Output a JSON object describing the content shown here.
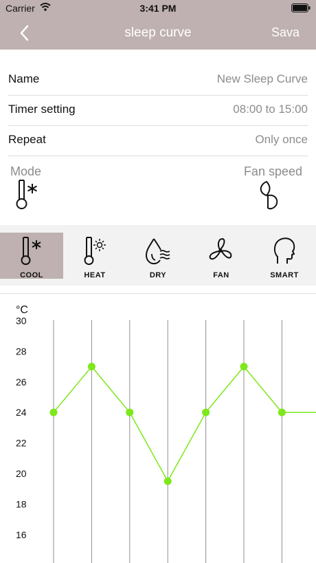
{
  "status_bar": {
    "carrier": "Carrier",
    "time": "3:41 PM"
  },
  "nav": {
    "title": "sleep curve",
    "save_label": "Sava",
    "back_icon": "chevron-left-icon"
  },
  "settings": [
    {
      "label": "Name",
      "value": "New Sleep Curve"
    },
    {
      "label": "Timer setting",
      "value": "08:00 to 15:00"
    },
    {
      "label": "Repeat",
      "value": "Only once"
    }
  ],
  "mode_section": {
    "mode_label": "Mode",
    "fan_label": "Fan speed",
    "mode_icon": "thermometer-snowflake-icon",
    "fan_icon": "fan-speed-icon"
  },
  "modes": [
    {
      "label": "COOL",
      "icon": "thermometer-snowflake-icon",
      "selected": true
    },
    {
      "label": "HEAT",
      "icon": "thermometer-sun-icon",
      "selected": false
    },
    {
      "label": "DRY",
      "icon": "droplet-waves-icon",
      "selected": false
    },
    {
      "label": "FAN",
      "icon": "fan-icon",
      "selected": false
    },
    {
      "label": "SMART",
      "icon": "head-profile-icon",
      "selected": false
    }
  ],
  "colors": {
    "accent": "#bfb1b1",
    "curve": "#7de81a",
    "strip": "#f2f2f2"
  },
  "chart_data": {
    "type": "line",
    "ylabel": "°C",
    "yticks": [
      30,
      28,
      26,
      24,
      22,
      20,
      18,
      16
    ],
    "ylim": [
      16,
      30
    ],
    "x": [
      1,
      2,
      3,
      4,
      5,
      6,
      7
    ],
    "values": [
      24,
      27,
      24,
      19.5,
      24,
      27,
      24
    ],
    "grid": "vertical lines at each point"
  }
}
